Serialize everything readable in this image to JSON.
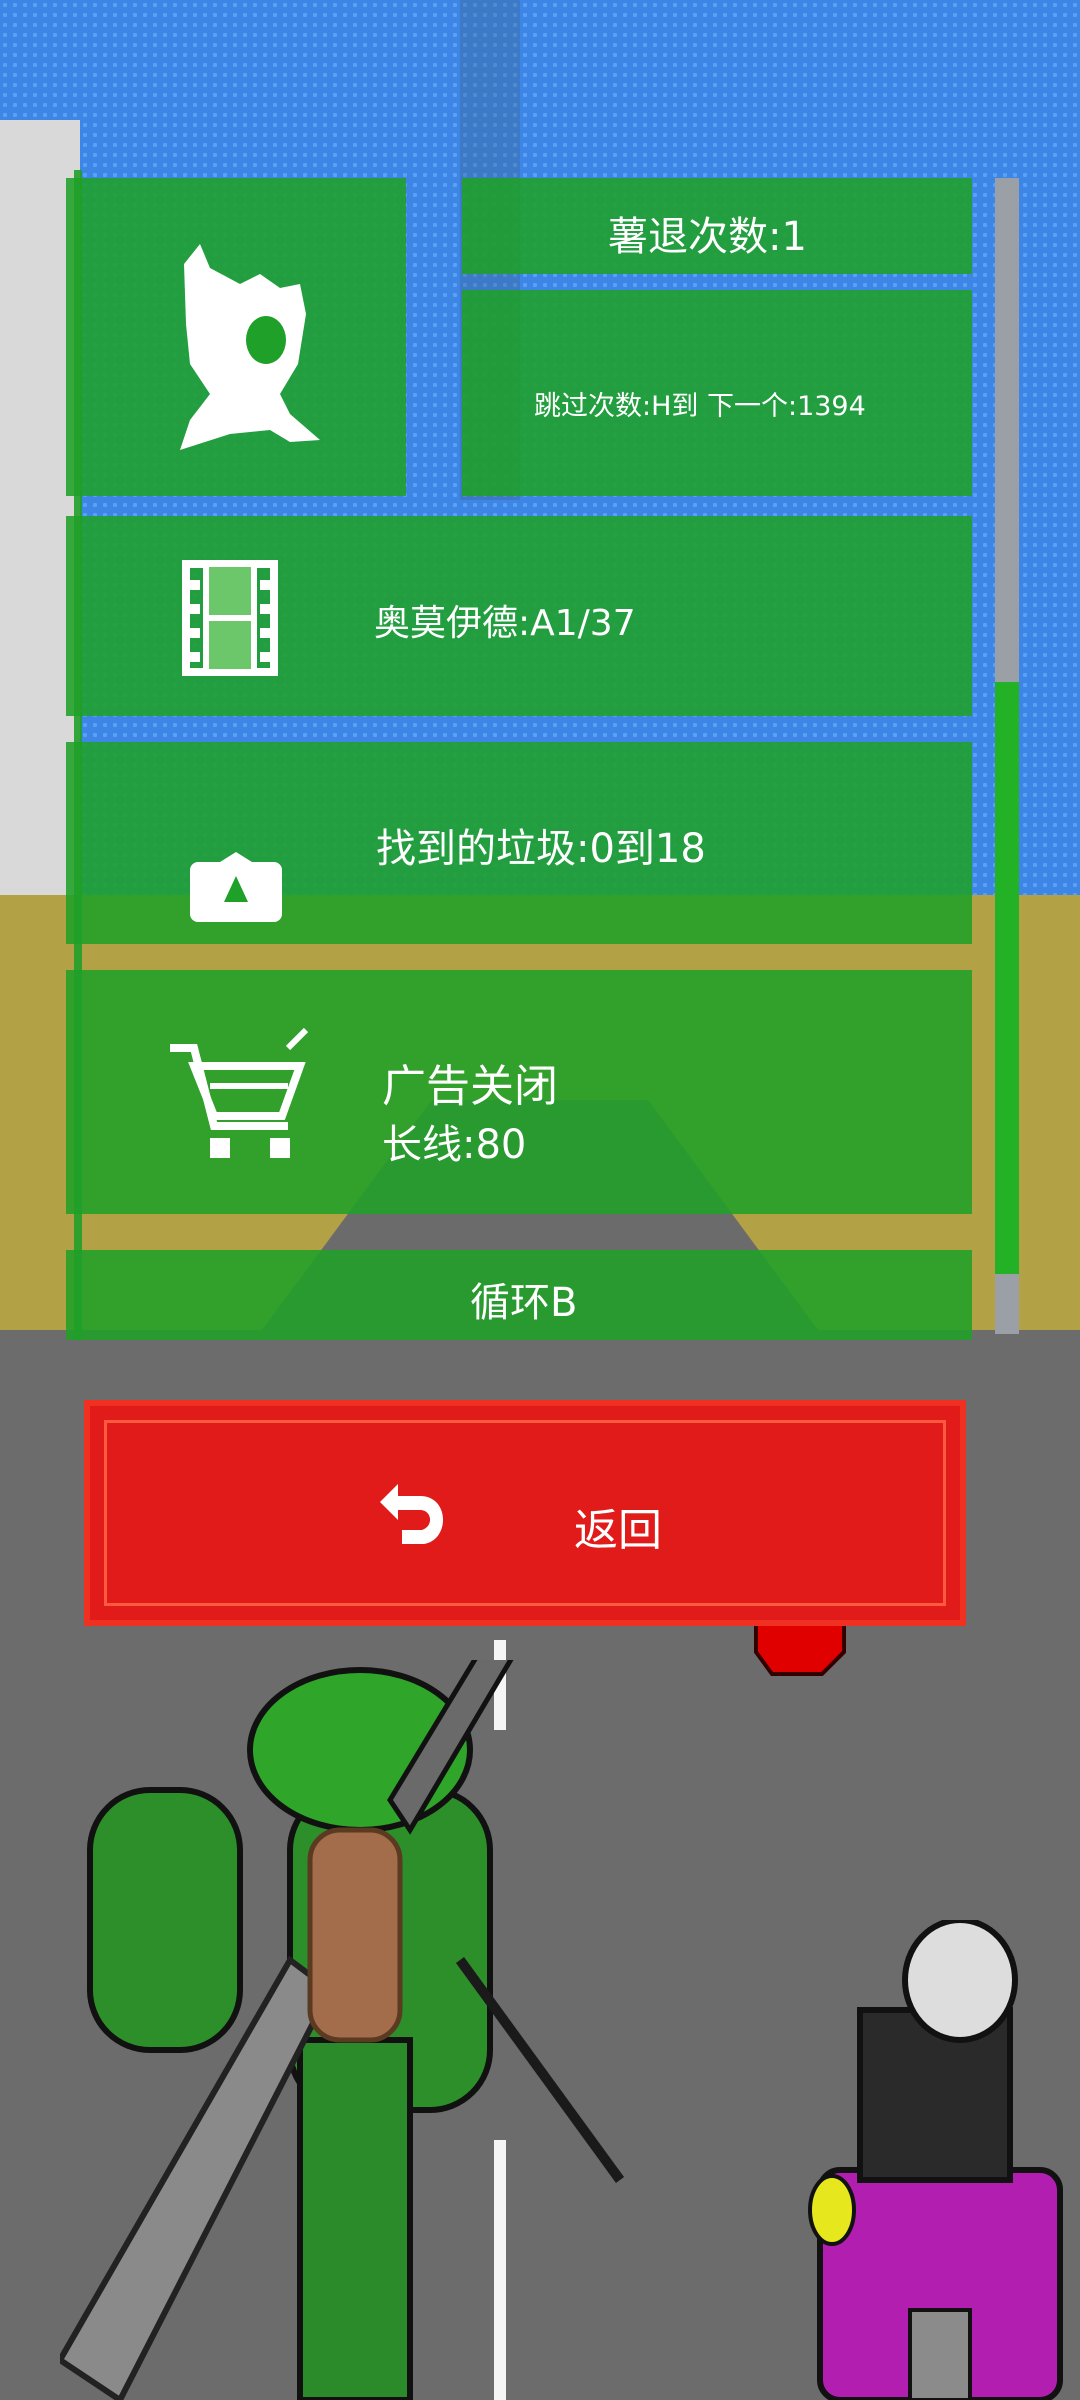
{
  "stats": {
    "retreat_count": "薯退次数:1",
    "skip_count": "跳过次数:H到 下一个:1394"
  },
  "menu": {
    "film_label": "奥莫伊德:A1/37",
    "trash_label": "找到的垃圾:0到18",
    "shop_line1": "广告关闭",
    "shop_line2": "长线:80",
    "loop_label": "循环B"
  },
  "back_button": {
    "label": "返回"
  },
  "scrollbar": {
    "position_fraction": 0.45
  },
  "icons": [
    "pet-icon",
    "film-icon",
    "trash-bin-icon",
    "cart-icon",
    "back-arrow-icon"
  ],
  "colors": {
    "tile": "#1fa028",
    "back": "#e11a1a",
    "sky": "#3d86e6",
    "sand": "#b3a146"
  }
}
